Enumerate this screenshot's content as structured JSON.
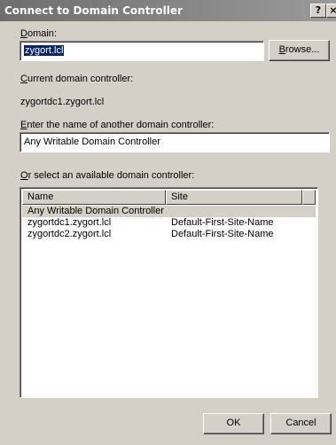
{
  "window": {
    "title": "Connect to Domain Controller",
    "help_label": "?",
    "close_label": "×"
  },
  "domain": {
    "label_mnemonic": "D",
    "label_rest": "omain:",
    "value": "zygort.lcl",
    "browse_mnemonic": "B",
    "browse_rest": "rowse..."
  },
  "current_dc": {
    "label_mnemonic": "C",
    "label_rest": "urrent domain controller:",
    "value": "zygortdc1.zygort.lcl"
  },
  "enter_dc": {
    "label_mnemonic": "E",
    "label_rest": "nter the name of another domain controller:",
    "value": "Any Writable Domain Controller"
  },
  "select_dc": {
    "label_mnemonic": "O",
    "label_rest": "r select an available domain controller:",
    "columns": [
      "Name",
      "Site"
    ],
    "rows": [
      {
        "name": "Any Writable Domain Controller",
        "site": "",
        "selected": true
      },
      {
        "name": "zygortdc1.zygort.lcl",
        "site": "Default-First-Site-Name",
        "selected": false
      },
      {
        "name": "zygortdc2.zygort.lcl",
        "site": "Default-First-Site-Name",
        "selected": false
      }
    ]
  },
  "footer": {
    "ok_label": "OK",
    "cancel_label": "Cancel"
  }
}
